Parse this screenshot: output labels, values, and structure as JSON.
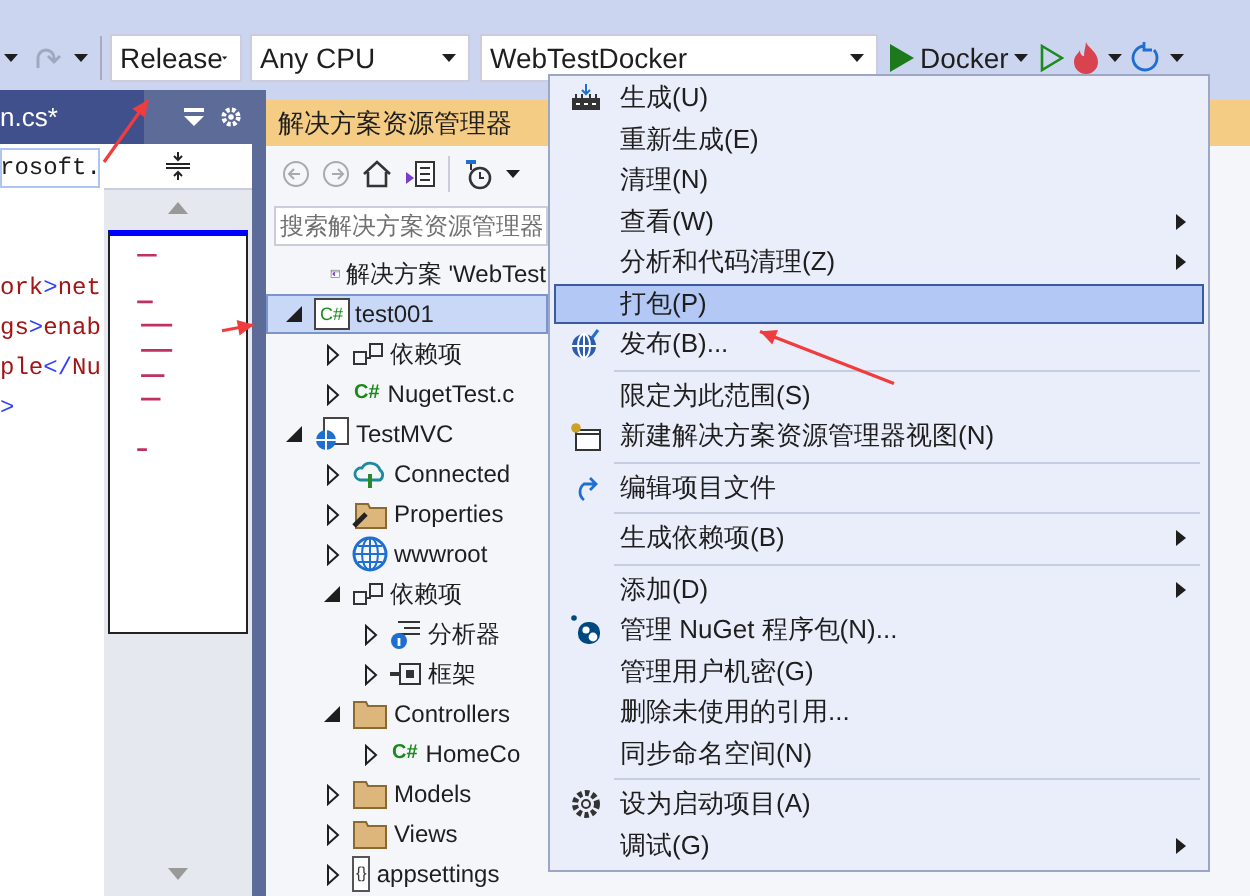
{
  "toolbar": {
    "configuration": "Release",
    "platform": "Any CPU",
    "startup_project": "WebTestDocker",
    "run_target": "Docker"
  },
  "editor": {
    "tab": "n.cs*",
    "lines": [
      {
        "text": "rosoft.",
        "highlighted": true
      },
      {
        "text": "ork>net",
        "highlighted": false
      },
      {
        "text": "gs>enab",
        "highlighted": false
      },
      {
        "text": "ple</Nu",
        "highlighted": false
      },
      {
        "text": ">",
        "highlighted": false
      }
    ]
  },
  "solution_explorer": {
    "title": "解决方案资源管理器",
    "search": {
      "placeholder": "搜索解决方案资源管理器"
    },
    "tree": [
      {
        "label": "解决方案 'WebTest",
        "kind": "solution",
        "selected": false,
        "expanded": true,
        "children": [
          {
            "label": "test001",
            "kind": "cs-project",
            "icon_text": "C#",
            "selected": true,
            "expanded": true,
            "children": [
              {
                "label": "依赖项",
                "kind": "dependencies",
                "selected": false,
                "expanded": false
              },
              {
                "label": "NugetTest.c",
                "kind": "cs-file",
                "icon_text": "C#",
                "selected": false,
                "expanded": false
              }
            ]
          },
          {
            "label": "TestMVC",
            "kind": "web-project",
            "selected": false,
            "expanded": true,
            "children": [
              {
                "label": "Connected",
                "kind": "connected",
                "selected": false,
                "expanded": false
              },
              {
                "label": "Properties",
                "kind": "properties",
                "selected": false,
                "expanded": false
              },
              {
                "label": "wwwroot",
                "kind": "globe",
                "selected": false,
                "expanded": false
              },
              {
                "label": "依赖项",
                "kind": "dependencies",
                "selected": false,
                "expanded": true,
                "children": [
                  {
                    "label": "分析器",
                    "kind": "analyzer",
                    "selected": false,
                    "expanded": false
                  },
                  {
                    "label": "框架",
                    "kind": "framework",
                    "selected": false,
                    "expanded": false
                  }
                ]
              },
              {
                "label": "Controllers",
                "kind": "folder",
                "selected": false,
                "expanded": true,
                "children": [
                  {
                    "label": "HomeCo",
                    "kind": "cs-file",
                    "icon_text": "C#",
                    "selected": false,
                    "expanded": false
                  }
                ]
              },
              {
                "label": "Models",
                "kind": "folder",
                "selected": false,
                "expanded": false
              },
              {
                "label": "Views",
                "kind": "folder",
                "selected": false,
                "expanded": false
              },
              {
                "label": "appsettings",
                "kind": "json",
                "icon_text": "{}",
                "selected": false,
                "expanded": false
              }
            ]
          }
        ]
      }
    ]
  },
  "context_menu": [
    {
      "kind": "item",
      "label": "生成(U)",
      "submenu": false,
      "selected": false
    },
    {
      "kind": "item",
      "label": "重新生成(E)",
      "submenu": false,
      "selected": false
    },
    {
      "kind": "item",
      "label": "清理(N)",
      "submenu": false,
      "selected": false
    },
    {
      "kind": "item",
      "label": "查看(W)",
      "submenu": true,
      "selected": false
    },
    {
      "kind": "item",
      "label": "分析和代码清理(Z)",
      "submenu": true,
      "selected": false
    },
    {
      "kind": "item",
      "label": "打包(P)",
      "submenu": false,
      "selected": true
    },
    {
      "kind": "item",
      "label": "发布(B)...",
      "submenu": false,
      "selected": false
    },
    {
      "kind": "separator"
    },
    {
      "kind": "item",
      "label": "限定为此范围(S)",
      "submenu": false,
      "selected": false
    },
    {
      "kind": "item",
      "label": "新建解决方案资源管理器视图(N)",
      "submenu": false,
      "selected": false
    },
    {
      "kind": "separator"
    },
    {
      "kind": "item",
      "label": "编辑项目文件",
      "submenu": false,
      "selected": false
    },
    {
      "kind": "separator"
    },
    {
      "kind": "item",
      "label": "生成依赖项(B)",
      "submenu": true,
      "selected": false
    },
    {
      "kind": "separator"
    },
    {
      "kind": "item",
      "label": "添加(D)",
      "submenu": true,
      "selected": false
    },
    {
      "kind": "item",
      "label": "管理 NuGet 程序包(N)...",
      "submenu": false,
      "selected": false
    },
    {
      "kind": "item",
      "label": "管理用户机密(G)",
      "submenu": false,
      "selected": false
    },
    {
      "kind": "item",
      "label": "删除未使用的引用...",
      "submenu": false,
      "selected": false
    },
    {
      "kind": "item",
      "label": "同步命名空间(N)",
      "submenu": false,
      "selected": false
    },
    {
      "kind": "separator"
    },
    {
      "kind": "item",
      "label": "设为启动项目(A)",
      "submenu": false,
      "selected": false
    },
    {
      "kind": "item",
      "label": "调试(G)",
      "submenu": true,
      "selected": false
    }
  ]
}
